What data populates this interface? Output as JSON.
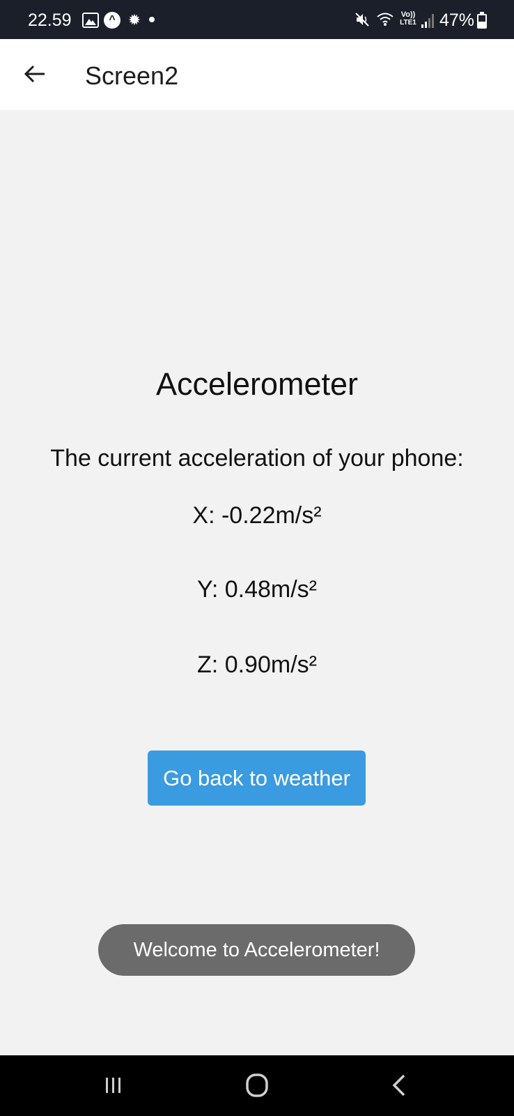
{
  "status_bar": {
    "time": "22.59",
    "battery_percent": "47%",
    "battery_level": 0.47,
    "network_label_top": "Vo))",
    "network_label_bottom": "LTE1",
    "icons": [
      "gallery-icon",
      "expo-icon",
      "bug-icon",
      "dot-icon",
      "mute-icon",
      "wifi-icon",
      "volte-icon",
      "signal-icon",
      "battery-icon"
    ]
  },
  "header": {
    "title": "Screen2",
    "back_icon": "arrow-left-icon"
  },
  "main": {
    "title": "Accelerometer",
    "description": "The current acceleration of your phone:",
    "x_value": "X: -0.22m/s²",
    "y_value": "Y: 0.48m/s²",
    "z_value": "Z: 0.90m/s²",
    "button_label": "Go back to weather"
  },
  "toast": {
    "message": "Welcome to Accelerometer!"
  },
  "nav_bar": {
    "icons": [
      "recents-icon",
      "home-icon",
      "back-icon"
    ]
  },
  "colors": {
    "status_bar_bg": "#1a1f2a",
    "header_bg": "#ffffff",
    "page_bg": "#f2f2f2",
    "button_bg": "#3a9be0",
    "toast_bg": "#6b6b6b",
    "nav_bar_bg": "#000000"
  }
}
